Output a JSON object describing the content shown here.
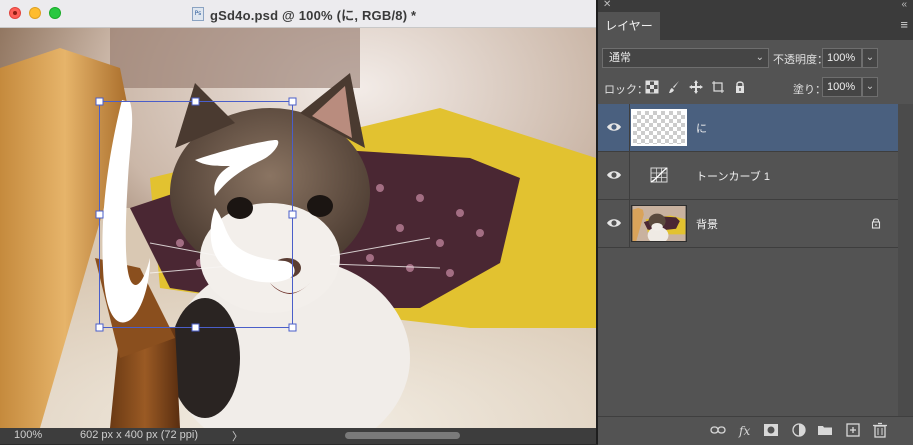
{
  "window": {
    "title": "gSd4o.psd @ 100% (に, RGB/8) *",
    "file_icon_text": "Ps"
  },
  "statusbar": {
    "zoom": "100%",
    "doc_size": "602 px x 400 px (72 ppi)",
    "arrow": "〉"
  },
  "panel": {
    "close_glyph": "✕",
    "collapse_glyph": "«",
    "tab_label": "レイヤー",
    "menu_glyph": "≡",
    "blend_mode": "通常",
    "opacity_label": "不透明度：",
    "opacity_value": "100%",
    "lock_label": "ロック：",
    "fill_label": "塗り：",
    "fill_value": "100%",
    "chevron": "⌄"
  },
  "layers": [
    {
      "name": "に",
      "selected": true,
      "thumb": "transparent"
    },
    {
      "name": "トーンカーブ 1",
      "selected": false,
      "thumb": "curves"
    },
    {
      "name": "背景",
      "selected": false,
      "thumb": "photo",
      "locked": true
    }
  ],
  "colors": {
    "selection": "#4a607f",
    "panel_bg": "#535353",
    "transform_box": "#4a5ec9"
  }
}
